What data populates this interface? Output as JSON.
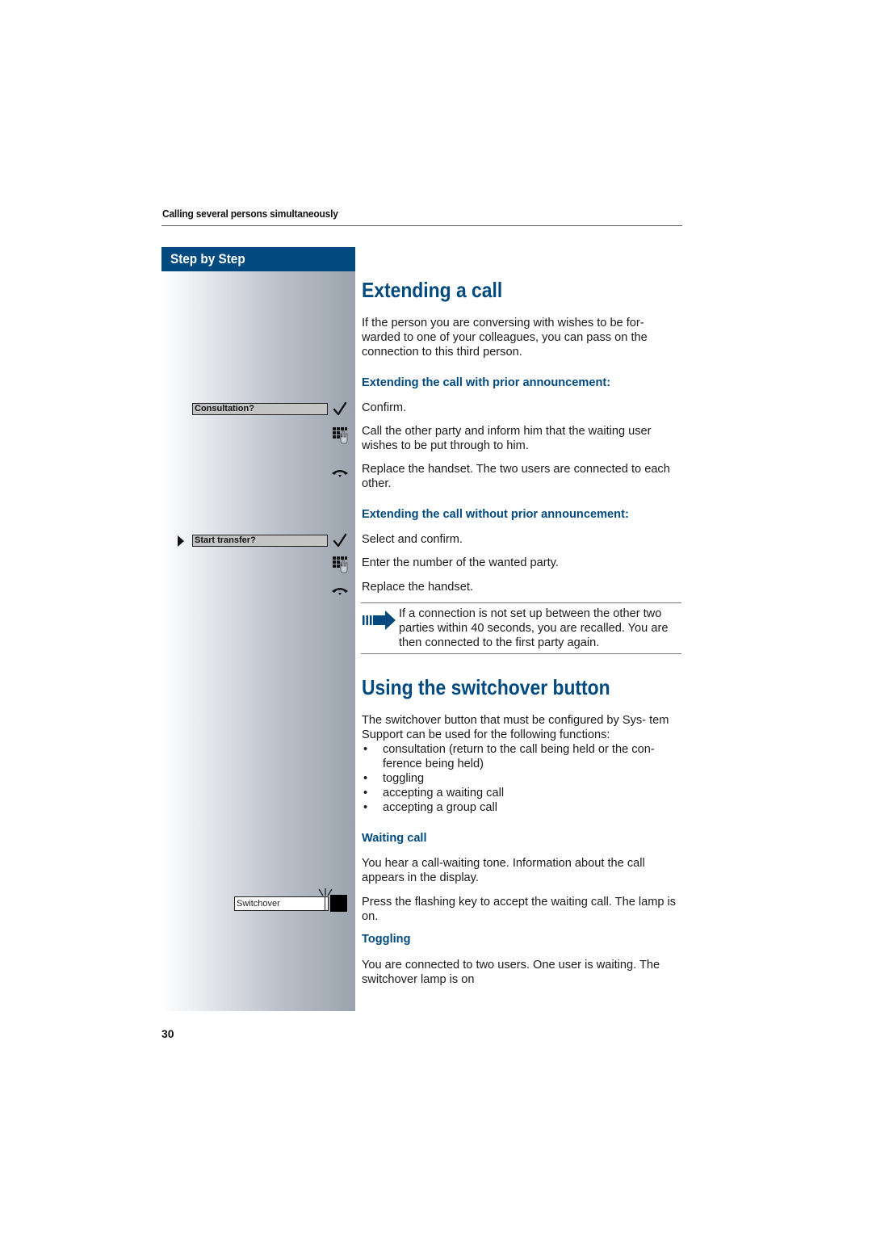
{
  "running_header": "Calling several persons simultaneously",
  "page_number": "30",
  "sidebar": {
    "title": "Step by Step",
    "display_items": [
      {
        "label": "Consultation?",
        "selected": false
      },
      {
        "label": "Start transfer?",
        "selected": true
      }
    ],
    "function_key": {
      "label": "Switchover",
      "lamp": "flashing"
    },
    "icons": [
      "checkmark-icon",
      "keypad-icon",
      "handset-down-icon",
      "checkmark-icon",
      "keypad-icon",
      "handset-down-icon",
      "flashing-lamp-icon"
    ]
  },
  "section1": {
    "title": "Extending a call",
    "intro": "If the person you are conversing with wishes to be for- warded to one of your colleagues, you can pass on the connection to this third person.",
    "intro_lines": [
      "If the person you are conversing with wishes to be for-",
      "warded to one of your colleagues, you can pass on the",
      "connection to this third person."
    ],
    "with_announcement": {
      "heading": "Extending the call with prior announcement:",
      "steps": [
        "Confirm.",
        "Call the other party and inform him that the waiting user wishes to be put through to him.",
        "Replace the handset. The two users are connected to each other."
      ]
    },
    "without_announcement": {
      "heading": "Extending the call without prior announcement:",
      "steps": [
        "Select and confirm.",
        "Enter the number of the wanted party.",
        "Replace the handset."
      ]
    },
    "note": "If a connection is not set up between the other two parties within 40 seconds, you are recalled. You are then connected to the first party again."
  },
  "section2": {
    "title": "Using the switchover button",
    "intro": "The switchover button that must be configured by Sys- tem Support can be used for the following functions:",
    "bullets": [
      "consultation (return to the call being held or the con- ference being held)",
      "toggling",
      "accepting a waiting call",
      "accepting a group call"
    ],
    "waiting_call": {
      "heading": "Waiting call",
      "text": "You hear a call-waiting tone. Information about the call appears in the display.",
      "step": "Press the flashing key to accept the waiting call. The lamp is on."
    },
    "toggling": {
      "heading": "Toggling",
      "text": "You are connected to two users. One user is waiting. The switchover lamp is on"
    }
  },
  "colors": {
    "brand_blue": "#004a7f",
    "text": "#1a1a1a"
  }
}
